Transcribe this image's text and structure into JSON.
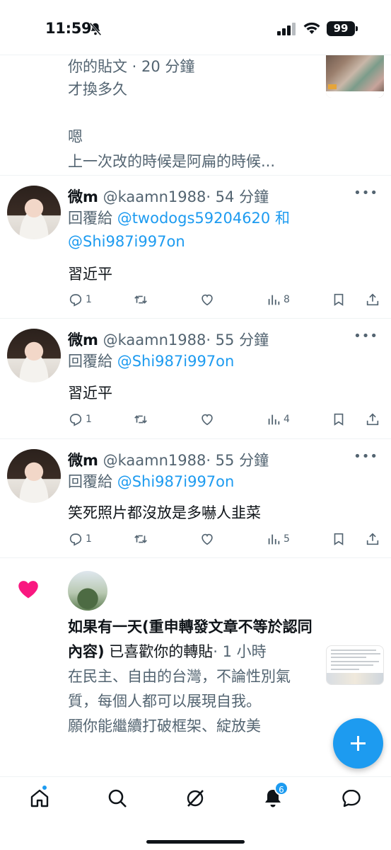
{
  "status_bar": {
    "time": "11:59",
    "battery": "99"
  },
  "post0": {
    "meta_line": "你的貼文 · 20 分鐘",
    "line1": "才換多久",
    "line2": "嗯",
    "line3": "上一次改的時候是阿扁的時候..."
  },
  "replies": [
    {
      "name": "微m",
      "handle": "@kaamn1988",
      "time": "· 54 分鐘",
      "reply_prefix": "回覆給",
      "reply_target_1": "@twodogs59204620",
      "reply_joiner": "和",
      "reply_target_2": "@Shi987i997on",
      "text": "習近平",
      "reply_count": "1",
      "views": "8"
    },
    {
      "name": "微m",
      "handle": "@kaamn1988",
      "time": "· 55 分鐘",
      "reply_prefix": "回覆給",
      "reply_target_1": "@Shi987i997on",
      "text": "習近平",
      "reply_count": "1",
      "views": "4"
    },
    {
      "name": "微m",
      "handle": "@kaamn1988",
      "time": "· 55 分鐘",
      "reply_prefix": "回覆給",
      "reply_target_1": "@Shi987i997on",
      "text": "笑死照片都沒放是多嚇人韭菜",
      "reply_count": "1",
      "views": "5"
    }
  ],
  "notification": {
    "actor": "如果有一天(重申轉發文章不等於認同內容)",
    "action": "已喜歡你的轉貼",
    "time": "· 1 小時",
    "line1": "在民主、自由的台灣，不論性別氣質，每個人都可以展現自我。",
    "line2": "願你能繼續打破框架、綻放美"
  },
  "tabbar": {
    "notifications_badge": "6"
  },
  "colors": {
    "accent": "#1d9bf0",
    "text": "#0f1419",
    "muted": "#536471",
    "like": "#f91880"
  }
}
